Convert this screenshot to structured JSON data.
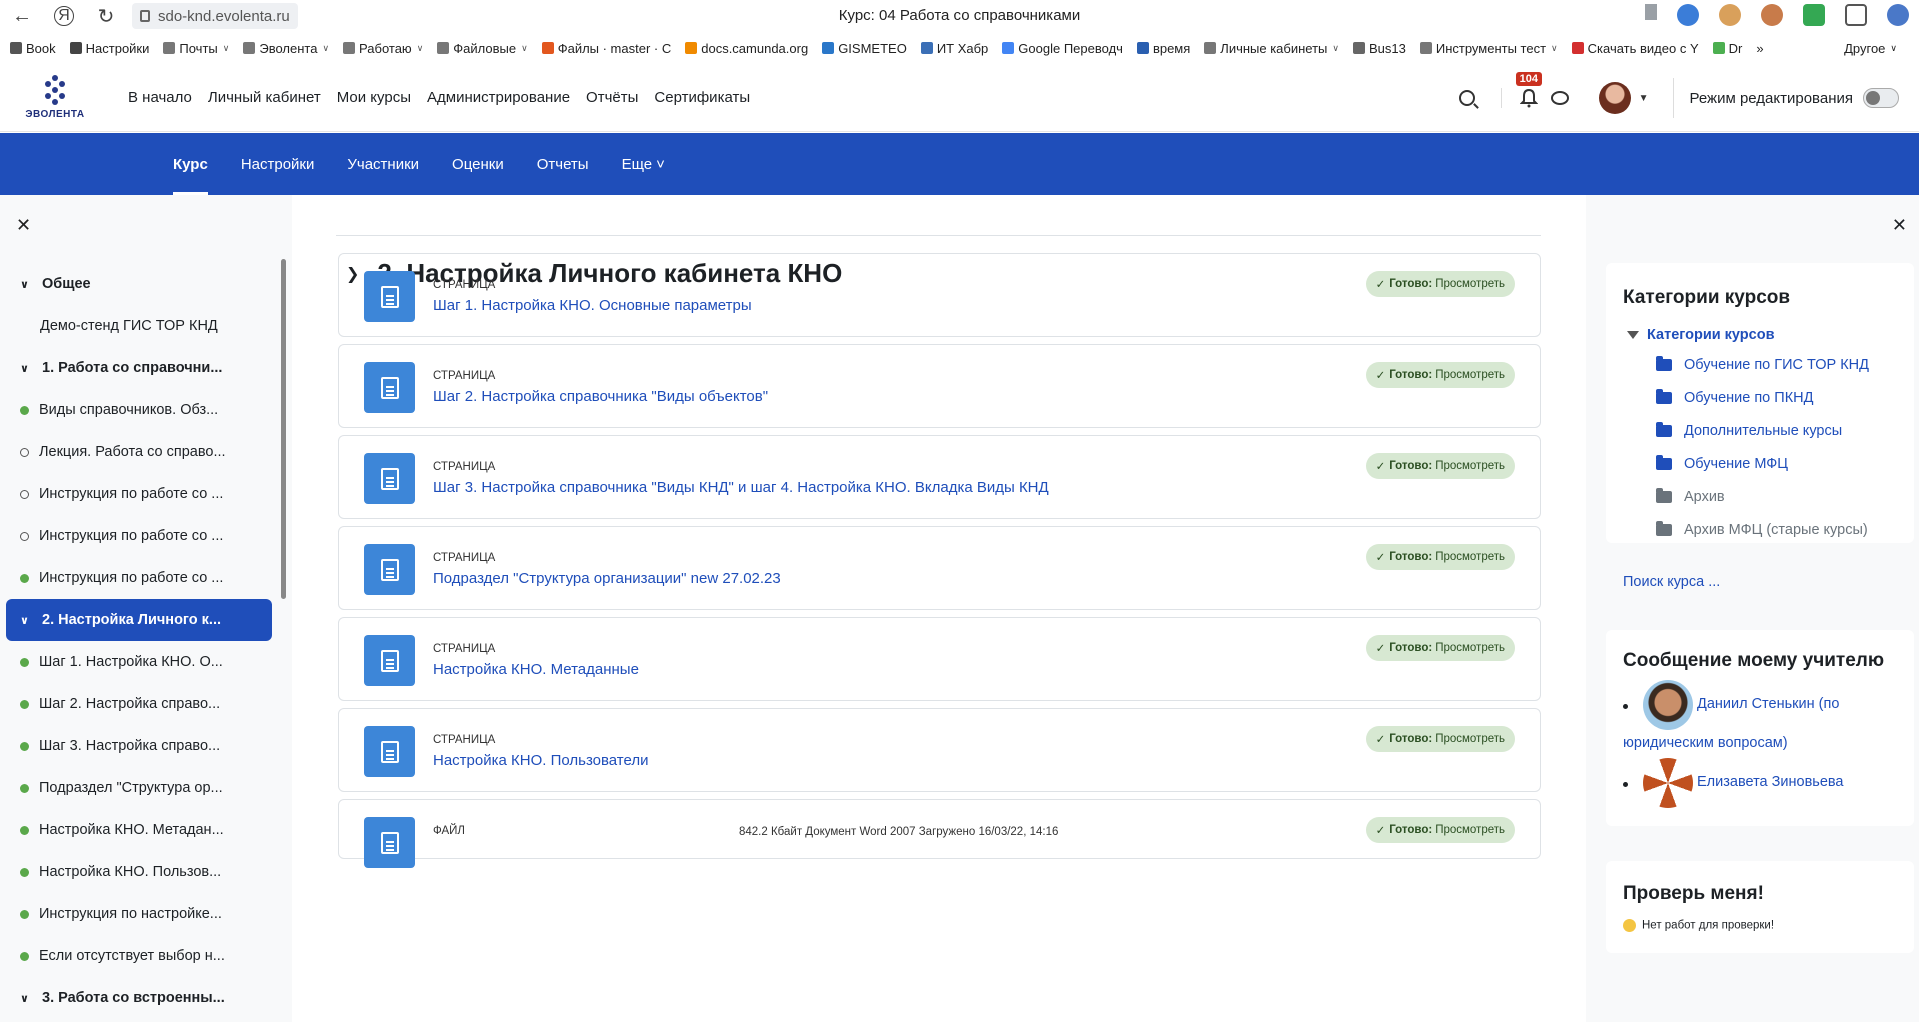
{
  "browser": {
    "url": "sdo-knd.evolenta.ru",
    "window_title": "Курс: 04 Работа со справочниками",
    "bookmarks": [
      {
        "label": "Book",
        "has_menu": false
      },
      {
        "label": "Настройки",
        "has_menu": false
      },
      {
        "label": "Почты",
        "has_menu": true
      },
      {
        "label": "Эволента",
        "has_menu": true
      },
      {
        "label": "Работаю",
        "has_menu": true
      },
      {
        "label": "Файловые",
        "has_menu": true
      },
      {
        "label": "Файлы · master · C",
        "has_menu": false
      },
      {
        "label": "docs.camunda.org",
        "has_menu": false
      },
      {
        "label": "GISMETEO",
        "has_menu": false
      },
      {
        "label": "ИТ Хабр",
        "has_menu": false
      },
      {
        "label": "Google Переводч",
        "has_menu": false
      },
      {
        "label": "время",
        "has_menu": false
      },
      {
        "label": "Личные кабинеты",
        "has_menu": true
      },
      {
        "label": "Bus13",
        "has_menu": false
      },
      {
        "label": "Инструменты тест",
        "has_menu": true
      },
      {
        "label": "Скачать видео с Y",
        "has_menu": false
      },
      {
        "label": "Dr",
        "has_menu": false
      }
    ],
    "more_bookmarks": "»",
    "other_bookmarks": "Другое"
  },
  "topnav": {
    "logo_text": "ЭВОЛЕНТА",
    "menu": [
      "В начало",
      "Личный кабинет",
      "Мои курсы",
      "Администрирование",
      "Отчёты",
      "Сертификаты"
    ],
    "notification_count": "104",
    "edit_mode_label": "Режим редактирования"
  },
  "secnav": {
    "tabs": [
      "Курс",
      "Настройки",
      "Участники",
      "Оценки",
      "Отчеты",
      "Еще"
    ]
  },
  "drawer": {
    "items": [
      {
        "label": "Общее",
        "kind": "section"
      },
      {
        "label": "Демо-стенд ГИС ТОР КНД",
        "kind": "plain"
      },
      {
        "label": "1. Работа со справочни...",
        "kind": "section"
      },
      {
        "label": "Виды справочников. Обз...",
        "kind": "done"
      },
      {
        "label": "Лекция. Работа со справо...",
        "kind": "todo"
      },
      {
        "label": "Инструкция по работе со ...",
        "kind": "todo"
      },
      {
        "label": "Инструкция по работе со ...",
        "kind": "todo"
      },
      {
        "label": "Инструкция по работе со ...",
        "kind": "done"
      },
      {
        "label": "2. Настройка Личного к...",
        "kind": "section-active"
      },
      {
        "label": "Шаг 1. Настройка КНО. О...",
        "kind": "done"
      },
      {
        "label": "Шаг 2. Настройка справо...",
        "kind": "done"
      },
      {
        "label": "Шаг 3. Настройка справо...",
        "kind": "done"
      },
      {
        "label": "Подраздел \"Структура ор...",
        "kind": "done"
      },
      {
        "label": "Настройка КНО. Метадан...",
        "kind": "done"
      },
      {
        "label": "Настройка КНО. Пользов...",
        "kind": "done"
      },
      {
        "label": "Инструкция по настройке...",
        "kind": "done"
      },
      {
        "label": "Если отсутствует выбор н...",
        "kind": "done"
      },
      {
        "label": "3. Работа со встроенны...",
        "kind": "section"
      }
    ]
  },
  "main": {
    "section_title": "2. Настройка Личного кабинета КНО",
    "activities": [
      {
        "kind": "СТРАНИЦА",
        "name": "Шаг 1. Настройка КНО. Основные параметры",
        "meta": "",
        "status_done": "Готово:",
        "status_action": "Просмотреть"
      },
      {
        "kind": "СТРАНИЦА",
        "name": "Шаг 2. Настройка справочника \"Виды объектов\"",
        "meta": "",
        "status_done": "Готово:",
        "status_action": "Просмотреть"
      },
      {
        "kind": "СТРАНИЦА",
        "name": "Шаг 3. Настройка справочника \"Виды КНД\" и шаг 4. Настройка КНО. Вкладка Виды КНД",
        "meta": "",
        "status_done": "Готово:",
        "status_action": "Просмотреть"
      },
      {
        "kind": "СТРАНИЦА",
        "name": "Подраздел \"Структура организации\" new 27.02.23",
        "meta": "",
        "status_done": "Готово:",
        "status_action": "Просмотреть"
      },
      {
        "kind": "СТРАНИЦА",
        "name": "Настройка КНО. Метаданные",
        "meta": "",
        "status_done": "Готово:",
        "status_action": "Просмотреть"
      },
      {
        "kind": "СТРАНИЦА",
        "name": "Настройка КНО. Пользователи",
        "meta": "",
        "status_done": "Готово:",
        "status_action": "Просмотреть"
      },
      {
        "kind": "ФАЙЛ",
        "name": "",
        "meta": "842.2 Кбайт Документ Word 2007 Загружено 16/03/22, 14:16",
        "status_done": "Готово:",
        "status_action": "Просмотреть"
      }
    ]
  },
  "right": {
    "categories_title": "Категории курсов",
    "categories_root": "Категории курсов",
    "categories": [
      {
        "label": "Обучение по ГИС ТОР КНД",
        "state": "active"
      },
      {
        "label": "Обучение по ПКНД",
        "state": "active"
      },
      {
        "label": "Дополнительные курсы",
        "state": "active"
      },
      {
        "label": "Обучение МФЦ",
        "state": "active"
      },
      {
        "label": "Архив",
        "state": "archived"
      },
      {
        "label": "Архив МФЦ (старые курсы)",
        "state": "archived"
      }
    ],
    "search_course": "Поиск курса ...",
    "message_title": "Сообщение моему учителю",
    "teachers": [
      {
        "line1": "Даниил Стенькин (по",
        "line2": "юридическим вопросам)"
      },
      {
        "line1": "Елизавета Зиновьева",
        "line2": ""
      }
    ],
    "check_title": "Проверь меня!",
    "check_text": "Нет работ для проверки!"
  },
  "colors": {
    "brand_blue": "#1f4eba",
    "done_green": "#5aa84a",
    "activity_icon": "#3d86d8"
  }
}
